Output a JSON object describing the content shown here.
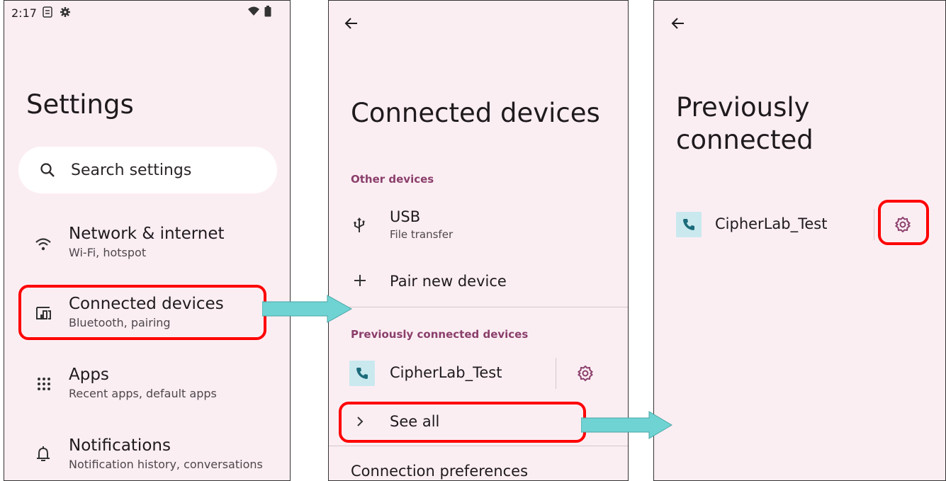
{
  "screen1": {
    "status": {
      "time": "2:17"
    },
    "title": "Settings",
    "search": {
      "placeholder": "Search settings"
    },
    "items": [
      {
        "title": "Network & internet",
        "subtitle": "Wi-Fi, hotspot",
        "icon": "wifi-icon"
      },
      {
        "title": "Connected devices",
        "subtitle": "Bluetooth, pairing",
        "icon": "devices-icon"
      },
      {
        "title": "Apps",
        "subtitle": "Recent apps, default apps",
        "icon": "apps-grid-icon"
      },
      {
        "title": "Notifications",
        "subtitle": "Notification history, conversations",
        "icon": "bell-icon"
      }
    ]
  },
  "screen2": {
    "title": "Connected devices",
    "other_header": "Other devices",
    "usb": {
      "title": "USB",
      "subtitle": "File transfer"
    },
    "pair": {
      "title": "Pair new device"
    },
    "prev_header": "Previously connected devices",
    "device": {
      "name": "CipherLab_Test"
    },
    "see_all": "See all",
    "conn_prefs": "Connection preferences"
  },
  "screen3": {
    "title_line1": "Previously",
    "title_line2": "connected",
    "device": {
      "name": "CipherLab_Test"
    }
  },
  "colors": {
    "background": "#fbeef3",
    "accent": "#8b3f6b",
    "highlight": "#ff0000",
    "arrow": "#6fd3d3",
    "device_tile": "#c9e9ef"
  }
}
